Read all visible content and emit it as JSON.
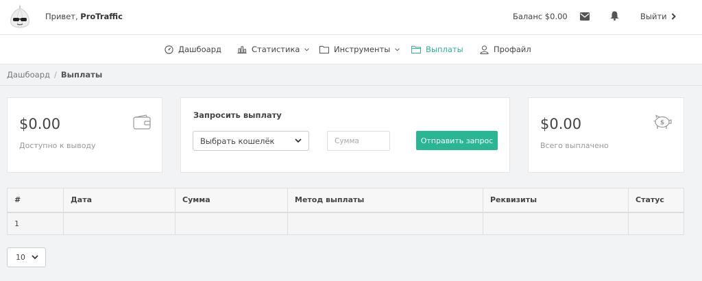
{
  "header": {
    "greeting_prefix": "Привет, ",
    "username": "ProTraffic",
    "balance": "Баланс $0.00",
    "logout_label": "Выйти"
  },
  "nav": {
    "items": [
      {
        "label": "Дашбоард",
        "icon": "gauge-icon"
      },
      {
        "label": "Статистика",
        "icon": "bar-chart-icon",
        "dropdown": true
      },
      {
        "label": "Инструменты",
        "icon": "folder-icon",
        "dropdown": true
      },
      {
        "label": "Выплаты",
        "icon": "folder-icon",
        "active": true
      },
      {
        "label": "Профайл",
        "icon": "user-icon"
      }
    ]
  },
  "breadcrumb": {
    "home": "Дашбоард",
    "current": "Выплаты"
  },
  "available_card": {
    "value": "$0.00",
    "label": "Доступно к выводу",
    "icon": "wallet-icon"
  },
  "request_card": {
    "title": "Запросить выплату",
    "wallet_select_value": "Выбрать кошелёк",
    "amount_placeholder": "Сумма",
    "submit_label": "Отправить запрос"
  },
  "paid_card": {
    "value": "$0.00",
    "label": "Всего выплачено",
    "icon": "piggy-bank-icon"
  },
  "table": {
    "columns": [
      "#",
      "Дата",
      "Сумма",
      "Метод выплаты",
      "Реквизиты",
      "Статус"
    ],
    "rows": [
      [
        "1",
        "",
        "",
        "",
        "",
        ""
      ]
    ]
  },
  "pagination": {
    "page_size": "10"
  },
  "colors": {
    "accent": "#2bb594",
    "button": "#28b693",
    "background": "#f2f3f5"
  }
}
